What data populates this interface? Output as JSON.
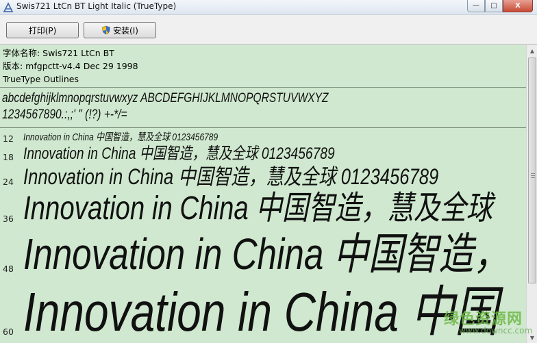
{
  "window": {
    "title": "Swis721 LtCn BT Light Italic (TrueType)",
    "icon": "font-viewer-icon",
    "controls": {
      "minimize": "—",
      "maximize": "□",
      "close": "X"
    }
  },
  "toolbar": {
    "print_label": "打印(P)",
    "install_label": "安装(I)",
    "install_icon": "uac-shield-icon"
  },
  "info": {
    "font_name": "字体名称: Swis721 LtCn BT",
    "version": "版本: mfgpctt-v4.4 Dec 29 1998",
    "outline_type": "TrueType Outlines"
  },
  "charset": {
    "line1": "abcdefghijklmnopqrstuvwxyz ABCDEFGHIJKLMNOPQRSTUVWXYZ",
    "line2": "1234567890.:,;' \" (!?) +-*/="
  },
  "samples": [
    {
      "size": "12",
      "text": "Innovation in China 中国智造，慧及全球 0123456789"
    },
    {
      "size": "18",
      "text": "Innovation in China 中国智造，慧及全球 0123456789"
    },
    {
      "size": "24",
      "text": "Innovation in China 中国智造，慧及全球 0123456789"
    },
    {
      "size": "36",
      "text": "Innovation in China 中国智造，慧及全球"
    },
    {
      "size": "48",
      "text": "Innovation in China 中国智造，"
    },
    {
      "size": "60",
      "text": "Innovation in China 中国"
    }
  ],
  "watermark": {
    "main": "绿色资源网",
    "sub": "www.downcc.com"
  },
  "colors": {
    "content_bg": "#cfe8cf",
    "watermark_green": "#6eb946"
  }
}
